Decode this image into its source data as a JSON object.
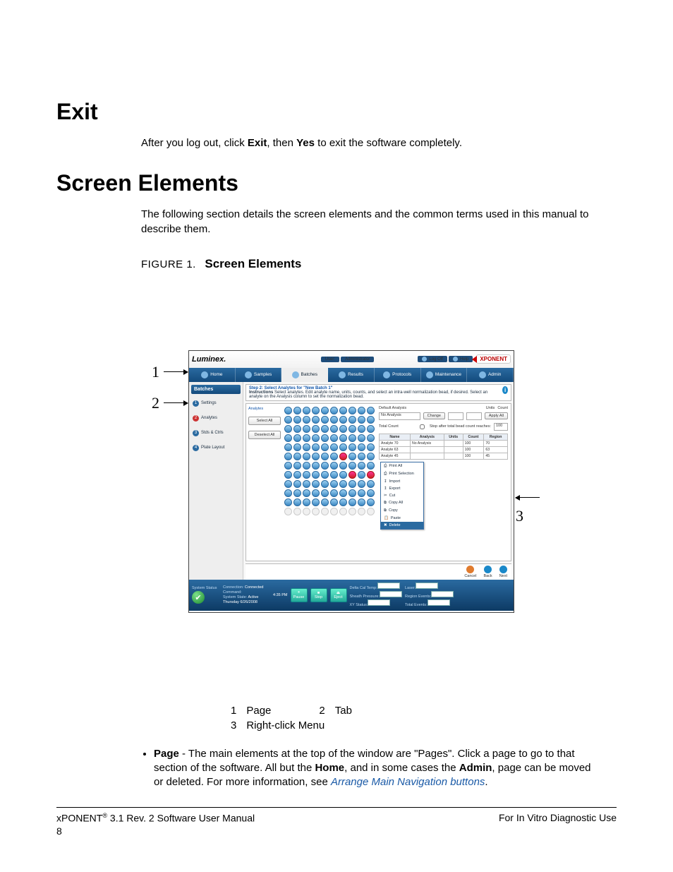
{
  "headings": {
    "exit": "Exit",
    "screen_elements": "Screen Elements"
  },
  "paragraphs": {
    "exit_body_pre": "After you log out, click ",
    "exit_bold1": "Exit",
    "exit_mid": ", then ",
    "exit_bold2": "Yes",
    "exit_post": " to exit the software completely.",
    "se_intro": "The following section details the screen elements and the common terms used in this manual to describe them."
  },
  "figure": {
    "lead": "FIGURE 1.",
    "title": "Screen Elements",
    "callouts": {
      "c1": "1",
      "c2": "2",
      "c3": "3"
    }
  },
  "legend": {
    "i1n": "1",
    "i1t": "Page",
    "i2n": "2",
    "i2t": "Tab",
    "i3n": "3",
    "i3t": "Right-click Menu"
  },
  "bullet": {
    "term": "Page",
    "dash": " - ",
    "body_a": "The main elements at the top of the window are \"Pages\". Click a page to go to that section of the software. All but the ",
    "bold1": "Home",
    "body_b": ", and in some cases the ",
    "bold2": "Admin",
    "body_c": ", page can be moved or deleted. For more information, see ",
    "link": "Arrange Main Navigation buttons",
    "period": "."
  },
  "footer": {
    "left_a": "xPONENT",
    "left_reg": "®",
    "left_b": " 3.1 Rev. 2 Software User Manual",
    "right": "For In Vitro Diagnostic Use",
    "page": "8"
  },
  "app": {
    "brand": "Luminex.",
    "user_label": "User:",
    "user_value": "Administrator",
    "topbuttons": {
      "logoff": "Log Off",
      "help": "Help"
    },
    "logo": "XPONENT",
    "pages": [
      "Home",
      "Samples",
      "Batches",
      "Results",
      "Protocols",
      "Maintenance",
      "Admin"
    ],
    "pages_active_index": 2,
    "tabs_header": "Batches",
    "tabs": [
      {
        "n": "1",
        "label": "Settings"
      },
      {
        "n": "2",
        "label": "Analytes"
      },
      {
        "n": "3",
        "label": "Stds & Ctrls"
      },
      {
        "n": "4",
        "label": "Plate Layout"
      }
    ],
    "tabs_active_index": 1,
    "instruction_step": "Step 2: Select Analytes for \"New Batch 1\"",
    "instruction_label": "Instructions",
    "instruction_text": "Select analytes. Edit analyte name, units, counts, and select an intra-well normalization bead, if desired. Select an analyte on the Analysis column to set the normalization bead.",
    "left_labels": {
      "analytes": "Analytes"
    },
    "left_buttons": {
      "select_all": "Select All",
      "deselect_all": "Deselect All"
    },
    "right": {
      "default_analysis_label": "Default Analysis",
      "default_analysis_value": "No Analysis",
      "change": "Change",
      "units_h": "Units",
      "count_h": "Count",
      "apply_all": "Apply All",
      "total_count_label": "Total Count",
      "stop_label": "Stop after total bead count reaches:",
      "stop_value": "100",
      "table_headers": [
        "Name",
        "Analysis",
        "Units",
        "Count",
        "Region"
      ],
      "rows": [
        {
          "name": "Analyte 70",
          "analysis": "No Analysis",
          "units": "",
          "count": "100",
          "region": "70"
        },
        {
          "name": "Analyte 63",
          "analysis": "",
          "units": "",
          "count": "100",
          "region": "63"
        },
        {
          "name": "Analyte 45",
          "analysis": "",
          "units": "",
          "count": "100",
          "region": "45"
        }
      ]
    },
    "context_menu": [
      "Print All",
      "Print Selection",
      "Import",
      "Export",
      "Cut",
      "Copy All",
      "Copy",
      "Paste",
      "Delete"
    ],
    "context_highlight_index": 8,
    "navfooter": {
      "cancel": "Cancel",
      "back": "Back",
      "next": "Next"
    },
    "status": {
      "title": "System Status",
      "connection": "Connection:",
      "connection_v": "Connected",
      "command": "Command:",
      "system_state": "System State:",
      "system_state_v": "Active",
      "date": "Thursday 6/26/2008",
      "time": "4:35 PM",
      "btns": [
        "Pause",
        "Stop",
        "Eject"
      ],
      "mid_labels": [
        "Delta Cal Temp:",
        "Sheath Pressure:",
        "XY Status:"
      ],
      "right_labels": [
        "Laser:",
        "Region Events:",
        "Total Events:"
      ]
    }
  }
}
